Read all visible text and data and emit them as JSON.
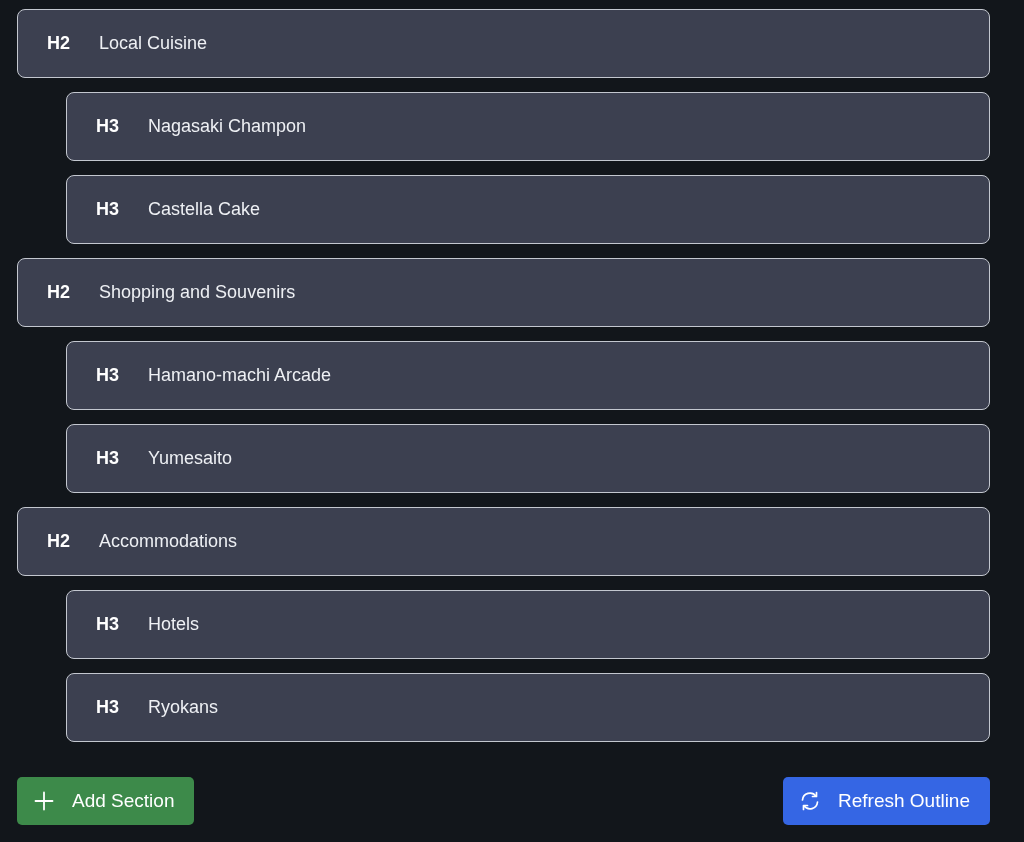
{
  "outline": [
    {
      "level": "H2",
      "title": "Local Cuisine",
      "children": [
        {
          "level": "H3",
          "title": "Nagasaki Champon"
        },
        {
          "level": "H3",
          "title": "Castella Cake"
        }
      ]
    },
    {
      "level": "H2",
      "title": "Shopping and Souvenirs",
      "children": [
        {
          "level": "H3",
          "title": "Hamano-machi Arcade"
        },
        {
          "level": "H3",
          "title": "Yumesaito"
        }
      ]
    },
    {
      "level": "H2",
      "title": "Accommodations",
      "children": [
        {
          "level": "H3",
          "title": "Hotels"
        },
        {
          "level": "H3",
          "title": "Ryokans"
        }
      ]
    }
  ],
  "actions": [
    {
      "kind": "add",
      "label": "Add Section"
    },
    {
      "kind": "refresh",
      "label": "Refresh Outline"
    }
  ]
}
